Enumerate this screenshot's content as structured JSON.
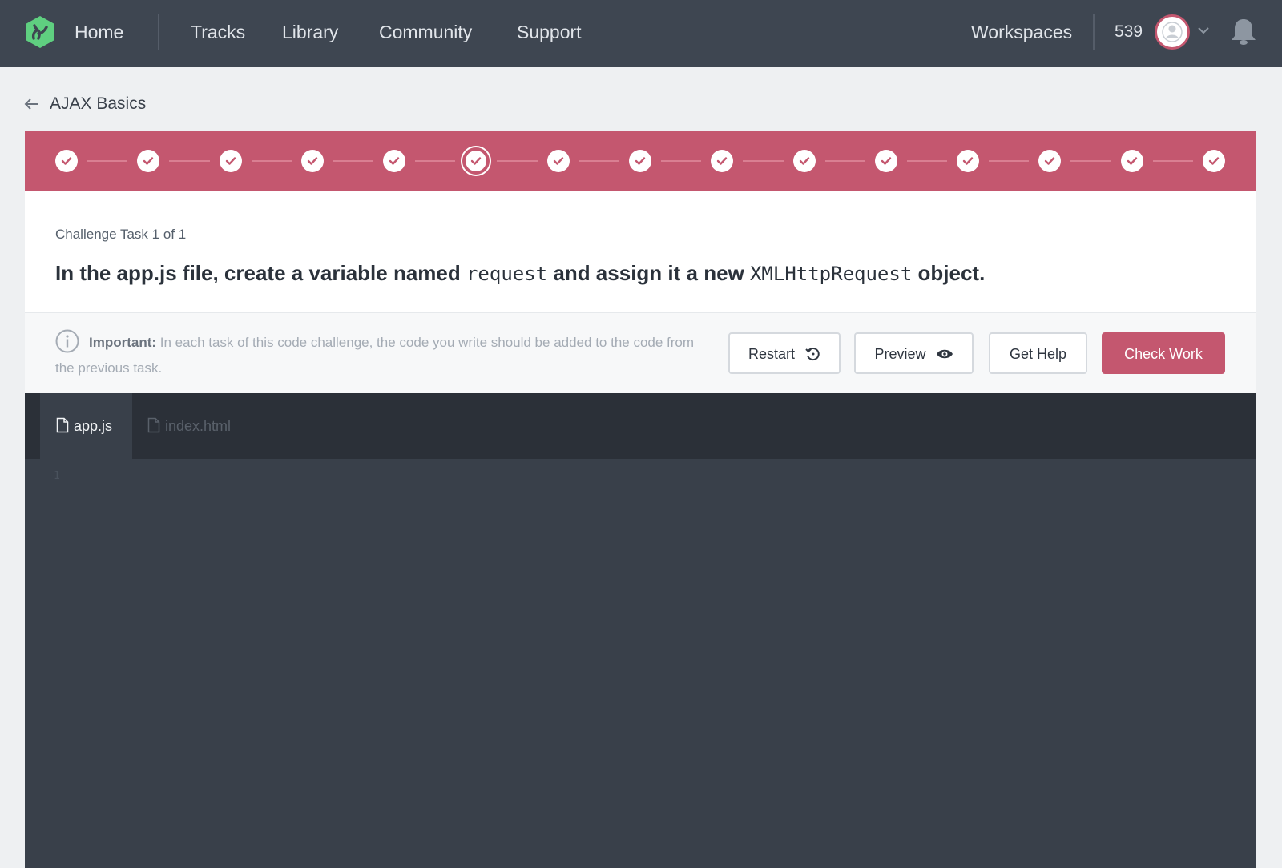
{
  "nav": {
    "home": "Home",
    "links": [
      "Tracks",
      "Library",
      "Community",
      "Support"
    ],
    "workspaces": "Workspaces",
    "points": "539"
  },
  "breadcrumb": {
    "title": "AJAX Basics"
  },
  "progress": {
    "total_steps": 15,
    "current_step": 6
  },
  "task": {
    "label": "Challenge Task 1 of 1",
    "title_parts": [
      "In the app.js file, create a variable named ",
      "request",
      " and assign it a new ",
      "XMLHttpRequest",
      " object."
    ]
  },
  "notice": {
    "bold": "Important:",
    "text": " In each task of this code challenge, the code you write should be added to the code from the previous task."
  },
  "buttons": {
    "restart": "Restart",
    "preview": "Preview",
    "help": "Get Help",
    "check": "Check Work"
  },
  "editor": {
    "tabs": [
      "app.js",
      "index.html"
    ],
    "line_number": "1"
  },
  "colors": {
    "accent": "#c4576f",
    "nav_bg": "#3e4651",
    "editor_bg": "#39404a",
    "logo_green": "#5fcf80"
  }
}
